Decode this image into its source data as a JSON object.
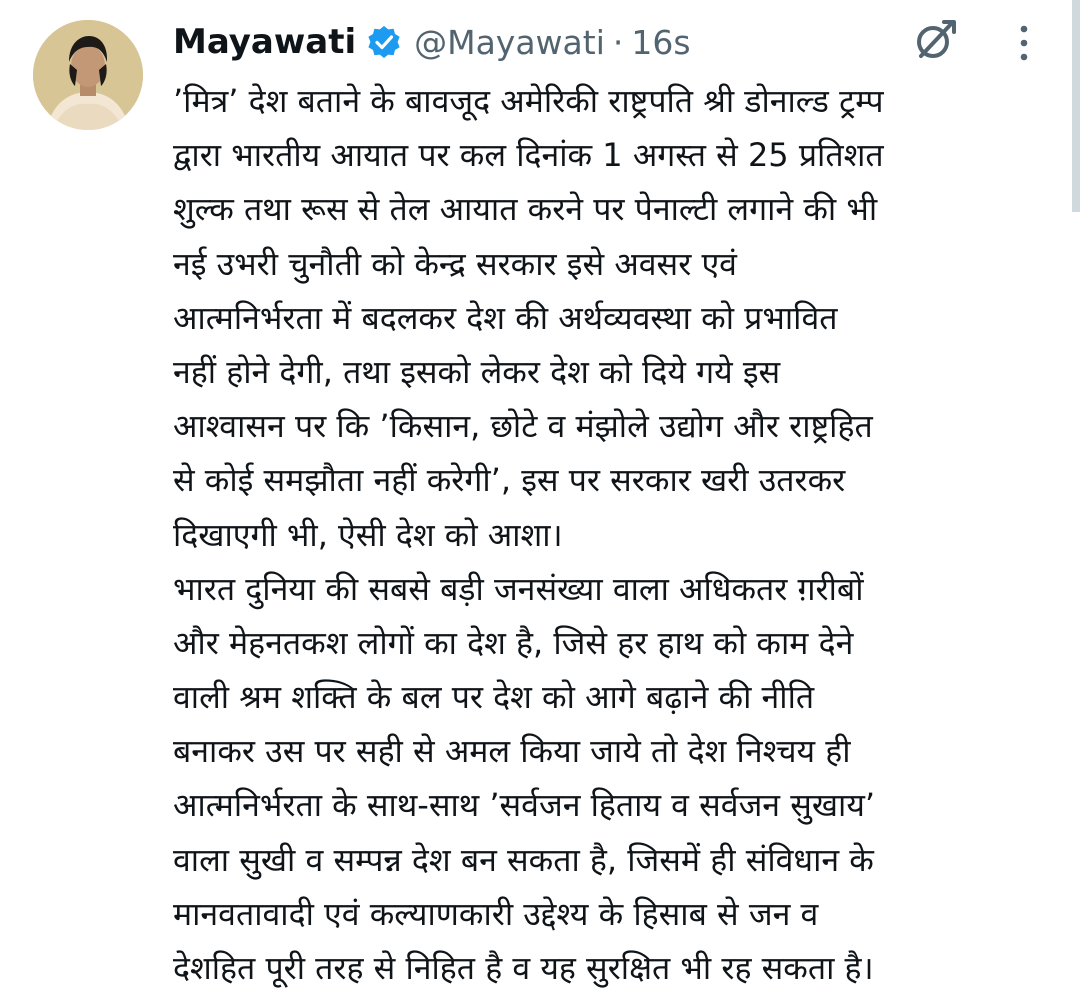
{
  "tweet": {
    "author_name": "Mayawati",
    "handle": "@Mayawati",
    "separator": "·",
    "time": "16s",
    "verified_color": "#1d9bf0",
    "icons": {
      "verified": "verified-badge-icon",
      "grok": "grok-icon",
      "more": "more-options-icon"
    },
    "lines": [
      "’मित्र’ देश बताने के बावजूद अमेरिकी राष्ट्रपति श्री डोनाल्ड ट्रम्प",
      "द्वारा भारतीय आयात पर कल दिनांक 1 अगस्त से 25 प्रतिशत",
      "शुल्क तथा रूस से तेल आयात करने पर पेनाल्टी लगाने की भी",
      "नई उभरी चुनौती को केन्द्र सरकार इसे अवसर एवं",
      "आत्मनिर्भरता में बदलकर देश की अर्थव्यवस्था को प्रभावित",
      "नहीं होने देगी, तथा इसको लेकर देश को दिये गये इस",
      "आश्वासन पर कि ’किसान, छोटे व मंझोले उद्योग और राष्ट्रहित",
      "से कोई समझौता नहीं करेगी’, इस पर सरकार खरी उतरकर",
      "दिखाएगी भी, ऐसी देश को आशा।",
      "भारत दुनिया की सबसे बड़ी जनसंख्या वाला अधिकतर ग़रीबों",
      "और मेहनतकश लोगों का देश है, जिसे हर हाथ को काम देने",
      "वाली श्रम शक्ति के बल पर देश को आगे बढ़ाने की नीति",
      "बनाकर उस पर सही से अमल किया जाये तो देश निश्चय ही",
      "आत्मनिर्भरता के साथ-साथ ’सर्वजन हिताय व सर्वजन सुखाय’",
      "वाला सुखी व सम्पन्न देश बन सकता है, जिसमें ही संविधान के",
      "मानवतावादी एवं कल्याणकारी उद्देश्य के हिसाब से जन व",
      "देशहित पूरी तरह से निहित है व यह सुरक्षित भी रह सकता है।"
    ]
  }
}
